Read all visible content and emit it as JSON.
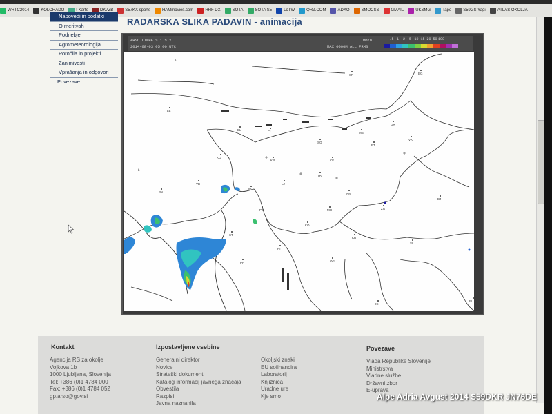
{
  "bookmarks": [
    "WRTC2014",
    "KOLORADO",
    "I Karte",
    "DK7ZB",
    "S57KX sports",
    "HAMmovies.com",
    "HHF DX",
    "SOTA",
    "SOTA S5",
    "LoTW",
    "QRZ.COM",
    "ADXO",
    "SMOCSS",
    "GMAIL",
    "UKSMG",
    "Tapo",
    "S59GS Yagi",
    "ATLAS OKOLJA"
  ],
  "nav": {
    "items": [
      "Napovedi in podatki",
      "O meritvah",
      "Podnebje",
      "Agrometeorologija",
      "Poročila in projekti",
      "Zanimivosti",
      "Vprašanja in odgovori",
      "Povezave"
    ]
  },
  "page_title": "RADARSKA SLIKA PADAVIN - animacija",
  "radar_header": {
    "line1": "ARSO LIMBE SI1 SI2",
    "line2": "2014-08-03 05:00 UTC",
    "right1": "mm/h",
    "right2": "MAX 0000M ALL PRMS",
    "legend_ticks": [
      "",
      ".5",
      "1",
      "2",
      "5",
      "10",
      "15",
      "20",
      "50",
      "100"
    ],
    "legend_colors": [
      "#1a1aa0",
      "#1f5fd0",
      "#2ea0e0",
      "#31c4c0",
      "#3cc070",
      "#7ed040",
      "#d8d830",
      "#f0a030",
      "#e04020",
      "#b01060",
      "#a030b0",
      "#c070d8"
    ]
  },
  "map_cities": [
    "LE",
    "GR",
    "BL",
    "CL",
    "MB",
    "SG",
    "PT",
    "VK",
    "CE",
    "KR",
    "MS",
    "LJ",
    "NM",
    "VR",
    "ID",
    "PO",
    "FN",
    "KO",
    "BR",
    "ZG",
    "PM",
    "PR",
    "RI",
    "OG",
    "SI",
    "BJ",
    "KR",
    "OS",
    "KL",
    "BL",
    "PL",
    "SP",
    "TR",
    "MH",
    "IC",
    "ZA"
  ],
  "footer": {
    "col1_title": "Kontakt",
    "col1_lines": [
      "Agencija RS za okolje",
      "Vojkova 1b",
      "1000 Ljubljana, Slovenija",
      "Tel: +386 (0)1 4784 000",
      "Fax: +386 (0)1 4784 052",
      "gp.arso@gov.si"
    ],
    "col2_title": "Izpostavljene vsebine",
    "col2_lines": [
      "Generalni direktor",
      "Novice",
      "Strateški dokumenti",
      "Katalog informacij javnega značaja",
      "Obvestila",
      "Razpisi",
      "Javna naznanila"
    ],
    "col3_lines": [
      "Okoljski znaki",
      "EU sofinancira",
      "Laboratorij",
      "Knjižnica",
      "Uradne ure",
      "Kje smo"
    ],
    "col4_title": "Povezave",
    "col4_lines": [
      "Vlada Republike Slovenije",
      "Ministrstva",
      "Vladne službe",
      "Državni zbor",
      "E-uprava"
    ]
  },
  "caption": "Alpe Adria Avgust 2014 S59DKR JN76DE"
}
